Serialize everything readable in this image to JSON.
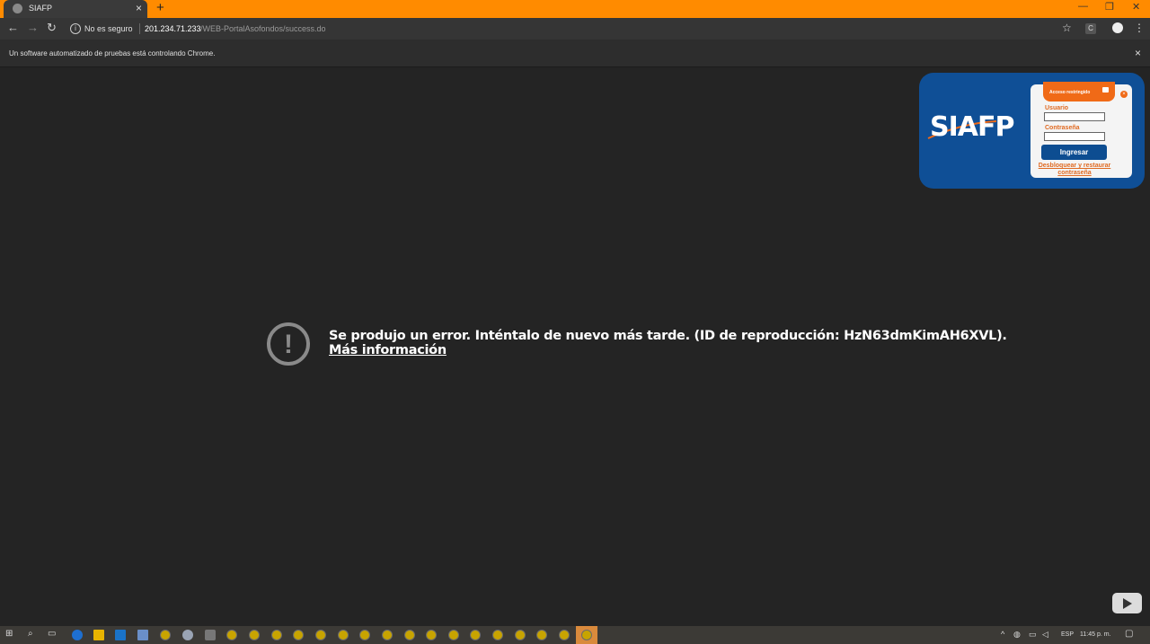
{
  "browser": {
    "tab_title": "SIAFP",
    "tab_close": "×",
    "new_tab": "+",
    "window_controls": [
      "—",
      "❐",
      "✕"
    ],
    "security_label": "No es seguro",
    "url_host": "201.234.71.233",
    "url_path": "/WEB-PortalAsofondos/success.do",
    "extension_label": "C",
    "automation_notice": "Un software automatizado de pruebas está controlando Chrome.",
    "automation_close": "×",
    "tab_strip_color": "#ff8b00"
  },
  "login_widget": {
    "logo": "SIAFP",
    "header": "Acceso restringido",
    "close": "×",
    "user_label": "Usuario",
    "user_value": "",
    "password_label": "Contraseña",
    "password_value": "",
    "submit_label": "Ingresar",
    "unlock_link": "Desbloquear y restaurar contraseña",
    "brand_color": "#0f4f96",
    "accent_color": "#f06a17"
  },
  "player_error": {
    "message": "Se produjo un error. Inténtalo de nuevo más tarde. (ID de reproducción: HzN63dmKimAH6XVL).",
    "link": "Más información",
    "icon": "!"
  },
  "taskbar": {
    "language": "ESP",
    "clock": "11:45 p. m."
  }
}
